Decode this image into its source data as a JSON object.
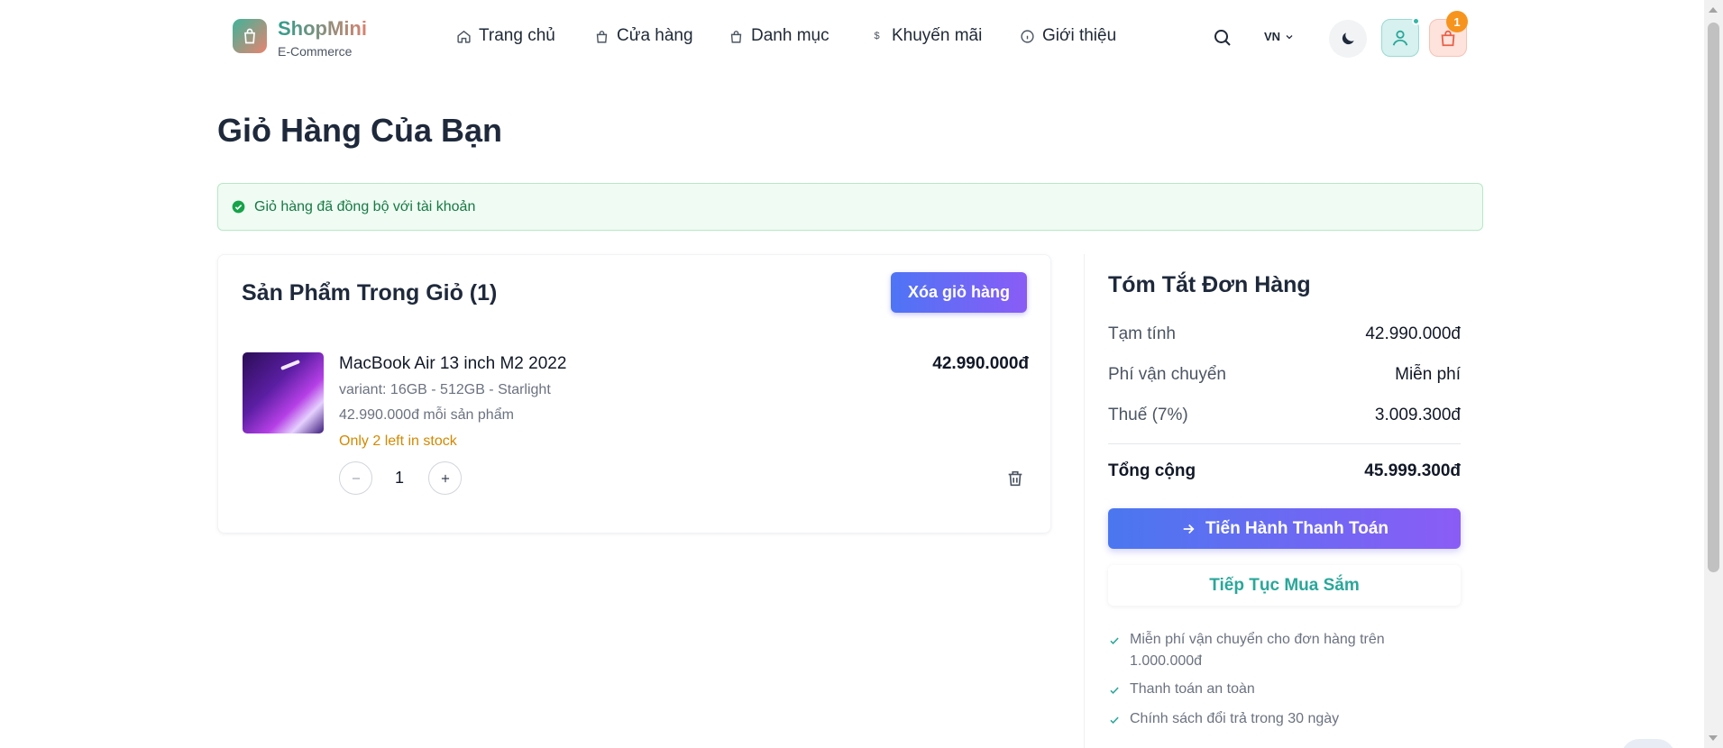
{
  "brand": {
    "name": "ShopMini",
    "subtitle": "E-Commerce"
  },
  "nav": [
    {
      "label": "Trang chủ",
      "icon": "home-icon"
    },
    {
      "label": "Cửa hàng",
      "icon": "shopping-bag-icon"
    },
    {
      "label": "Danh mục",
      "icon": "category-bag-icon"
    },
    {
      "label": "Khuyến mãi",
      "icon": "dollar-icon"
    },
    {
      "label": "Giới thiệu",
      "icon": "info-icon"
    }
  ],
  "header": {
    "language": "VN",
    "cart_count": "1"
  },
  "page": {
    "title": "Giỏ Hàng Của Bạn"
  },
  "alert": {
    "text": "Giỏ hàng đã đồng bộ với tài khoản"
  },
  "cart": {
    "heading": "Sản Phẩm Trong Giỏ (1)",
    "clear_label": "Xóa giỏ hàng",
    "items": [
      {
        "name": "MacBook Air 13 inch M2 2022",
        "variant": "variant: 16GB - 512GB - Starlight",
        "unit_price": "42.990.000đ mỗi sản phẩm",
        "stock": "Only 2 left in stock",
        "quantity": "1",
        "total": "42.990.000đ"
      }
    ]
  },
  "summary": {
    "title": "Tóm Tắt Đơn Hàng",
    "subtotal_label": "Tạm tính",
    "subtotal": "42.990.000đ",
    "shipping_label": "Phí vận chuyển",
    "shipping": "Miễn phí",
    "tax_label": "Thuế (7%)",
    "tax": "3.009.300đ",
    "total_label": "Tổng cộng",
    "total": "45.999.300đ",
    "checkout_label": "Tiến Hành Thanh Toán",
    "continue_label": "Tiếp Tục Mua Sắm",
    "features": [
      "Miễn phí vận chuyển cho đơn hàng trên 1.000.000đ",
      "Thanh toán an toàn",
      "Chính sách đổi trả trong 30 ngày"
    ]
  },
  "colors": {
    "accent_start": "#4e74f5",
    "accent_end": "#8a5cf6",
    "teal": "#2aa79a",
    "success": "#167a43",
    "warning": "#d38900"
  }
}
